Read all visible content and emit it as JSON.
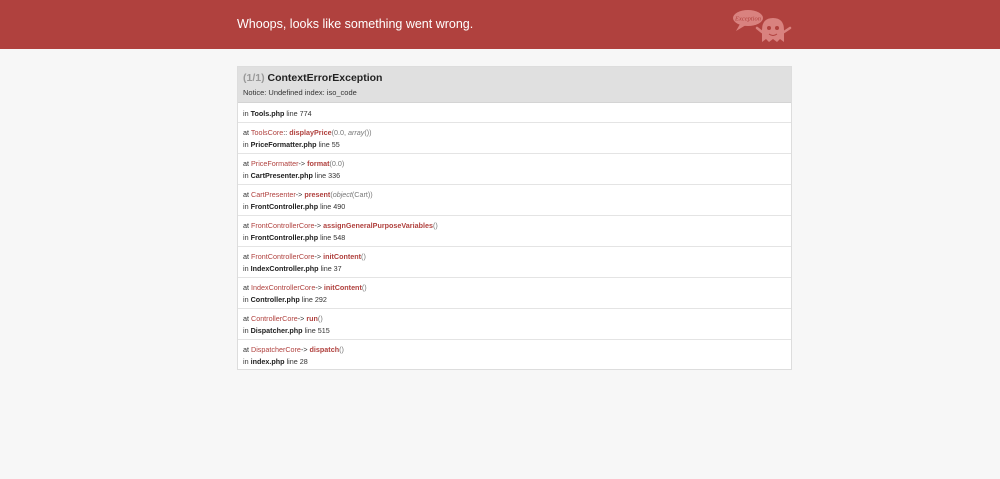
{
  "header": {
    "title": "Whoops, looks like something went wrong.",
    "badge_text": "Exception",
    "color": "#b0413e"
  },
  "exception": {
    "count": "(1/1)",
    "name": "ContextErrorException",
    "message": "Notice: Undefined index: iso_code"
  },
  "trace": [
    {
      "file": "Tools.php",
      "line": "line 774"
    },
    {
      "class": "ToolsCore",
      "sep": "::",
      "method": "displayPrice",
      "args": "(0.0, ",
      "args_italic": "array",
      "args_end": "())",
      "file": "PriceFormatter.php",
      "line": "line 55"
    },
    {
      "class": "PriceFormatter",
      "sep": "->",
      "method": "format",
      "args": "(0.0)",
      "args_italic": "",
      "args_end": "",
      "file": "CartPresenter.php",
      "line": "line 336"
    },
    {
      "class": "CartPresenter",
      "sep": "->",
      "method": "present",
      "args": "(",
      "args_italic": "object",
      "args_end": "(Cart))",
      "file": "FrontController.php",
      "line": "line 490"
    },
    {
      "class": "FrontControllerCore",
      "sep": "->",
      "method": "assignGeneralPurposeVariables",
      "args": "()",
      "args_italic": "",
      "args_end": "",
      "file": "FrontController.php",
      "line": "line 548"
    },
    {
      "class": "FrontControllerCore",
      "sep": "->",
      "method": "initContent",
      "args": "()",
      "args_italic": "",
      "args_end": "",
      "file": "IndexController.php",
      "line": "line 37"
    },
    {
      "class": "IndexControllerCore",
      "sep": "->",
      "method": "initContent",
      "args": "()",
      "args_italic": "",
      "args_end": "",
      "file": "Controller.php",
      "line": "line 292"
    },
    {
      "class": "ControllerCore",
      "sep": "->",
      "method": "run",
      "args": "()",
      "args_italic": "",
      "args_end": "",
      "file": "Dispatcher.php",
      "line": "line 515"
    },
    {
      "class": "DispatcherCore",
      "sep": "->",
      "method": "dispatch",
      "args": "()",
      "args_italic": "",
      "args_end": "",
      "file": "index.php",
      "line": "line 28"
    }
  ],
  "labels": {
    "at": "at",
    "in": "in"
  }
}
